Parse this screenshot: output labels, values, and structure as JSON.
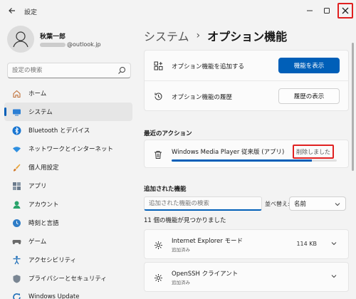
{
  "window": {
    "title": "設定"
  },
  "profile": {
    "name": "秋葉一郎",
    "email_suffix": "@outlook.jp"
  },
  "search": {
    "placeholder": "設定の検索"
  },
  "nav": {
    "items": [
      {
        "label": "ホーム",
        "icon": "home-icon"
      },
      {
        "label": "システム",
        "icon": "system-icon",
        "active": true
      },
      {
        "label": "Bluetooth とデバイス",
        "icon": "bluetooth-icon"
      },
      {
        "label": "ネットワークとインターネット",
        "icon": "network-icon"
      },
      {
        "label": "個人用設定",
        "icon": "brush-icon"
      },
      {
        "label": "アプリ",
        "icon": "apps-icon"
      },
      {
        "label": "アカウント",
        "icon": "account-icon"
      },
      {
        "label": "時刻と言語",
        "icon": "time-language-icon"
      },
      {
        "label": "ゲーム",
        "icon": "game-icon"
      },
      {
        "label": "アクセシビリティ",
        "icon": "accessibility-icon"
      },
      {
        "label": "プライバシーとセキュリティ",
        "icon": "shield-icon"
      },
      {
        "label": "Windows Update",
        "icon": "update-icon"
      }
    ]
  },
  "breadcrumb": {
    "parent": "システム",
    "separator": "›",
    "current": "オプション機能"
  },
  "add_feature": {
    "label": "オプション機能を追加する",
    "button": "機能を表示"
  },
  "history": {
    "label": "オプション機能の履歴",
    "button": "履歴の表示"
  },
  "recent": {
    "title": "最近のアクション",
    "item_name": "Windows Media Player 従来版 (アプリ)",
    "status": "削除しました",
    "progress": 0.85
  },
  "installed": {
    "title": "追加された機能",
    "filter_placeholder": "追加された機能の検索",
    "sort_label": "並べ替え:",
    "sort_value": "名前",
    "count_text": "11 個の機能が見つかりました",
    "features": [
      {
        "name": "Internet Explorer モード",
        "status": "追加済み",
        "size": "114 KB"
      },
      {
        "name": "OpenSSH クライアント",
        "status": "追加済み",
        "size": ""
      }
    ]
  },
  "colors": {
    "accent": "#005fb8",
    "highlight": "#e02020",
    "background": "#f3f3f3"
  }
}
